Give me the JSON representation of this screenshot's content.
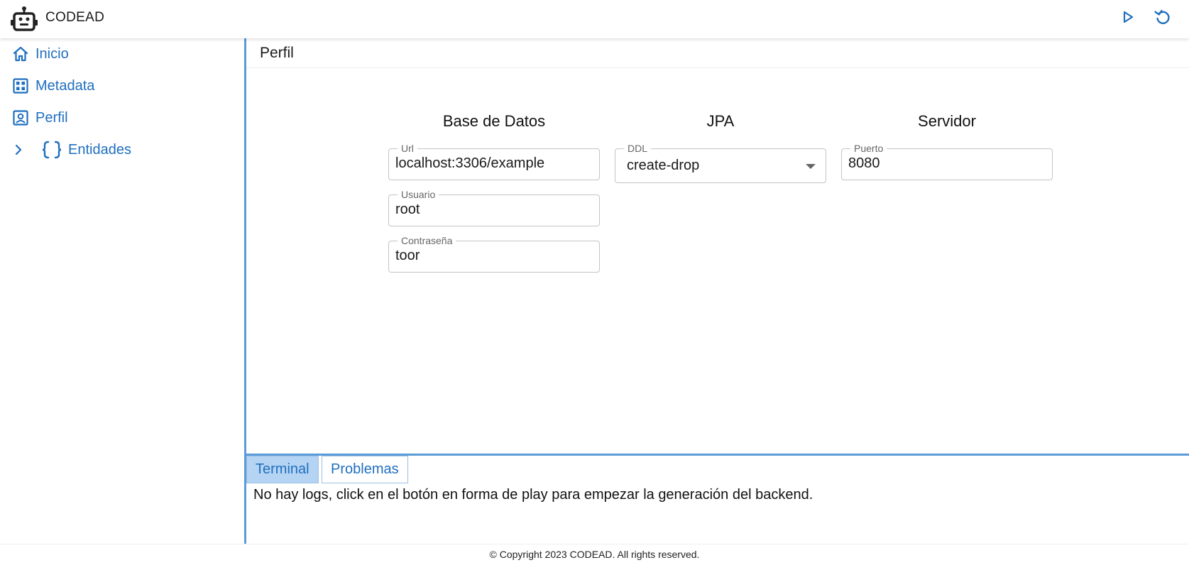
{
  "header": {
    "title": "CODEAD",
    "icons": {
      "logo": "robot-icon",
      "play": "play-icon",
      "reset": "refresh-icon"
    },
    "accent_color": "#1f6fbf"
  },
  "sidebar": {
    "items": [
      {
        "label": "Inicio",
        "icon": "home-icon"
      },
      {
        "label": "Metadata",
        "icon": "grid-icon"
      },
      {
        "label": "Perfil",
        "icon": "profile-icon"
      },
      {
        "label": "Entidades",
        "icon": "braces-icon",
        "collapsed": true
      }
    ]
  },
  "main": {
    "page_title": "Perfil",
    "database": {
      "heading": "Base de Datos",
      "url_label": "Url",
      "url_value": "localhost:3306/example",
      "user_label": "Usuario",
      "user_value": "root",
      "password_label": "Contraseña",
      "password_value": "toor"
    },
    "jpa": {
      "heading": "JPA",
      "ddl_label": "DDL",
      "ddl_value": "create-drop"
    },
    "server": {
      "heading": "Servidor",
      "port_label": "Puerto",
      "port_value": "8080"
    }
  },
  "panel": {
    "tabs": [
      {
        "label": "Terminal",
        "active": true
      },
      {
        "label": "Problemas",
        "active": false
      }
    ],
    "log_message": "No hay logs, click en el botón en forma de play para empezar la generación del backend."
  },
  "footer": {
    "copyright": "© Copyright 2023 CODEAD. All rights reserved."
  }
}
